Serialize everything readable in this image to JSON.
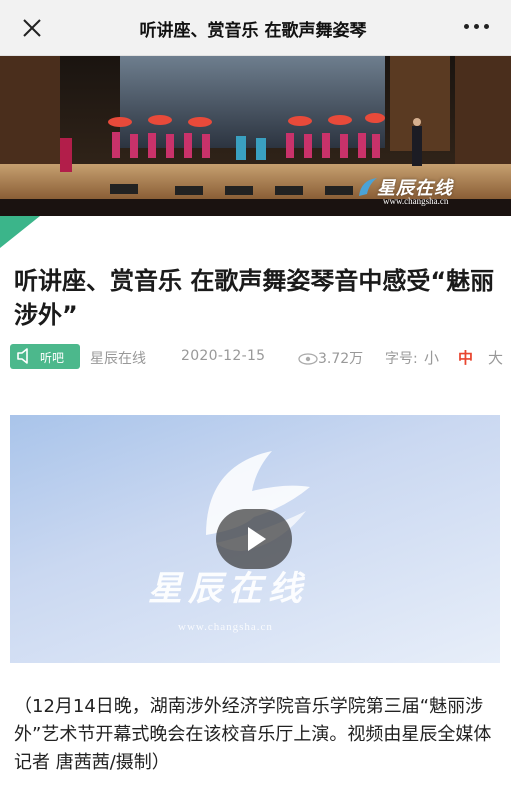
{
  "topbar": {
    "title": "听讲座、赏音乐 在歌声舞姿琴",
    "close_icon": "close-icon",
    "more_icon": "more-icon"
  },
  "hero": {
    "watermark_text": "星辰在线",
    "watermark_url": "www.changsha.cn"
  },
  "article": {
    "title": "听讲座、赏音乐 在歌声舞姿琴音中感受“魅丽涉外”",
    "listen_label": "听吧",
    "source": "星辰在线",
    "date": "2020-12-15",
    "views": "3.72万",
    "font_size_label": "字号:",
    "font_size_options": [
      "小",
      "中",
      "大"
    ],
    "font_size_selected": "中"
  },
  "video": {
    "logo_text": "星辰在线",
    "url": "www.changsha.cn"
  },
  "caption": "（12月14日晚，湖南涉外经济学院音乐学院第三届“魅丽涉外”艺术节开幕式晚会在该校音乐厅上演。视频由星辰全媒体记者 唐茜茜/摄制）",
  "colors": {
    "accent_green": "#4cb88c",
    "selected_red": "#e8452f",
    "meta_gray": "#999999"
  }
}
